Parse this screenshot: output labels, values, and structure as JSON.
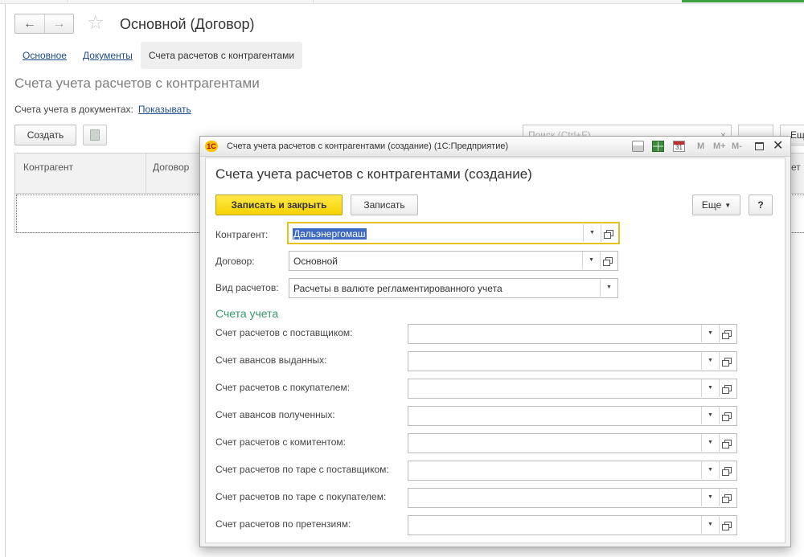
{
  "window": {
    "title": "Основной (Договор)",
    "nav_back": "←",
    "nav_forward": "→",
    "tabs": [
      {
        "label": "Основное"
      },
      {
        "label": "Документы"
      },
      {
        "label": "Счета расчетов с контрагентами"
      }
    ],
    "section_title": "Счета учета расчетов с контрагентами",
    "accounts_in_docs_label": "Счета учета в документах:",
    "accounts_in_docs_link": "Показывать",
    "create_button": "Создать",
    "search_placeholder": "Поиск (Ctrl+F)",
    "search_clear": "×",
    "more_button": "Ещ",
    "table": {
      "columns": [
        "Контрагент",
        "Договор",
        "ет"
      ]
    }
  },
  "dialog": {
    "window_title": "Счета учета расчетов с контрагентами (создание)  (1С:Предприятие)",
    "logo": "1С",
    "header_buttons": [
      "M",
      "M+",
      "M-"
    ],
    "calendar_day": "31",
    "close": "✕",
    "title": "Счета учета расчетов с контрагентами (создание)",
    "save_close_button": "Записать и закрыть",
    "save_button": "Записать",
    "more_button": "Еще",
    "help_button": "?",
    "fields": {
      "counterparty": {
        "label": "Контрагент:",
        "value": "Дальэнергомаш"
      },
      "contract": {
        "label": "Договор:",
        "value": "Основной"
      },
      "settlement_type": {
        "label": "Вид расчетов:",
        "value": "Расчеты в валюте регламентированного учета"
      }
    },
    "accounts_group_title": "Счета учета",
    "accounts": [
      {
        "label": "Счет расчетов с поставщиком:",
        "value": ""
      },
      {
        "label": "Счет авансов выданных:",
        "value": ""
      },
      {
        "label": "Счет расчетов с покупателем:",
        "value": ""
      },
      {
        "label": "Счет авансов полученных:",
        "value": ""
      },
      {
        "label": "Счет расчетов с комитентом:",
        "value": ""
      },
      {
        "label": "Счет расчетов по таре с поставщиком:",
        "value": ""
      },
      {
        "label": "Счет расчетов по таре с покупателем:",
        "value": ""
      },
      {
        "label": "Счет расчетов по претензиям:",
        "value": ""
      }
    ]
  }
}
